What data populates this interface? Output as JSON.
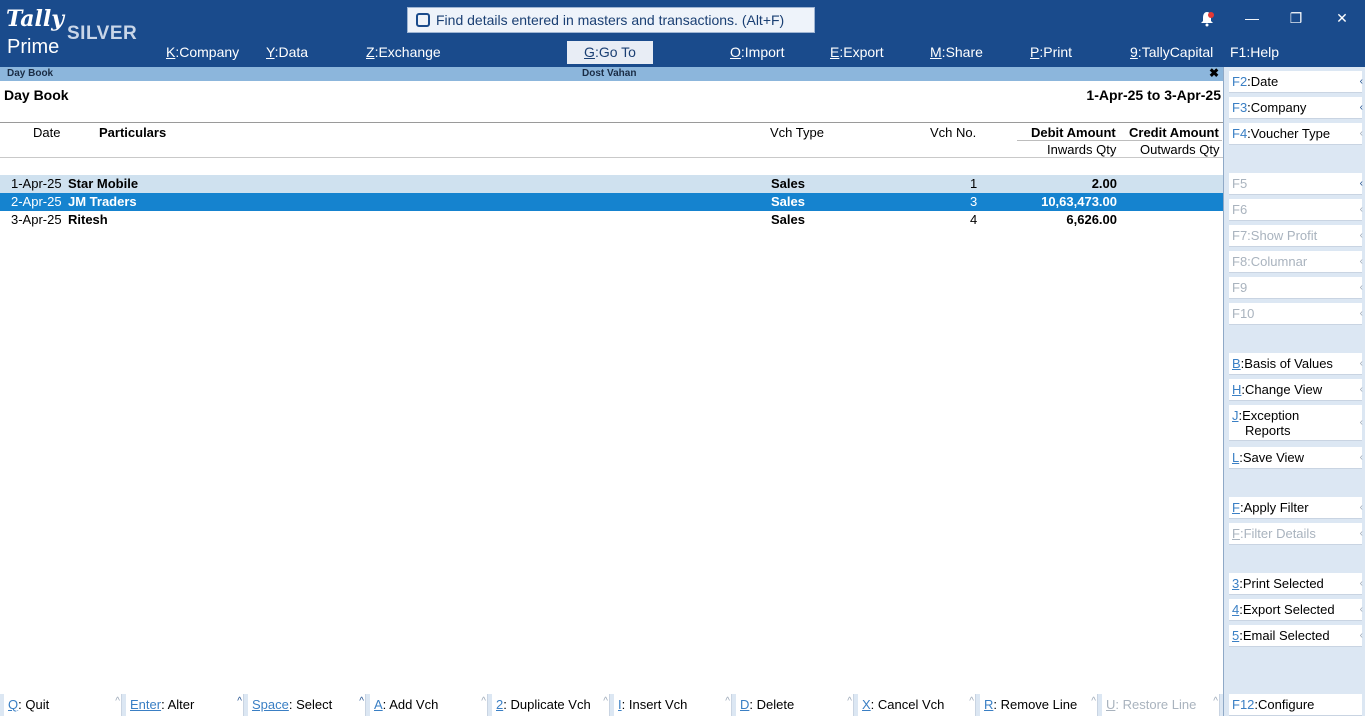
{
  "app": {
    "logo_tally": "Tally",
    "logo_prime": "Prime",
    "edition": "SILVER"
  },
  "search": {
    "placeholder": "Find details entered in masters and transactions. (Alt+F)"
  },
  "window_controls": {
    "minimize": "—",
    "restore": "❐",
    "close": "✕"
  },
  "top_menu": [
    {
      "key": "K",
      "label": "Company"
    },
    {
      "key": "Y",
      "label": "Data"
    },
    {
      "key": "Z",
      "label": "Exchange"
    },
    {
      "key": "G",
      "label": "Go To"
    },
    {
      "key": "O",
      "label": "Import"
    },
    {
      "key": "E",
      "label": "Export"
    },
    {
      "key": "M",
      "label": "Share"
    },
    {
      "key": "P",
      "label": "Print"
    },
    {
      "key": "9",
      "label": "TallyCapital"
    },
    {
      "key": "F1",
      "label": "Help"
    }
  ],
  "subbar": {
    "left": "Day Book",
    "center": "Dost Vahan",
    "close": "✖"
  },
  "report": {
    "title": "Day Book",
    "period": "1-Apr-25 to 3-Apr-25",
    "columns": {
      "date": "Date",
      "particulars": "Particulars",
      "vch_type": "Vch Type",
      "vch_no": "Vch No.",
      "debit": "Debit Amount",
      "credit": "Credit Amount",
      "inwards": "Inwards Qty",
      "outwards": "Outwards Qty"
    },
    "rows": [
      {
        "date": "1-Apr-25",
        "particulars": "Star Mobile",
        "vch_type": "Sales",
        "vch_no": "1",
        "debit": "2.00",
        "credit": ""
      },
      {
        "date": "2-Apr-25",
        "particulars": "JM Traders",
        "vch_type": "Sales",
        "vch_no": "3",
        "debit": "10,63,473.00",
        "credit": ""
      },
      {
        "date": "3-Apr-25",
        "particulars": "Ritesh",
        "vch_type": "Sales",
        "vch_no": "4",
        "debit": "6,626.00",
        "credit": ""
      }
    ]
  },
  "right_panel": [
    {
      "key": "F2",
      "label": "Date"
    },
    {
      "key": "F3",
      "label": "Company"
    },
    {
      "key": "F4",
      "label": "Voucher Type"
    },
    {
      "key": "F5",
      "label": ""
    },
    {
      "key": "F6",
      "label": ""
    },
    {
      "key": "F7",
      "label": "Show Profit"
    },
    {
      "key": "F8",
      "label": "Columnar"
    },
    {
      "key": "F9",
      "label": ""
    },
    {
      "key": "F10",
      "label": ""
    },
    {
      "key": "B",
      "label": "Basis of Values"
    },
    {
      "key": "H",
      "label": "Change View"
    },
    {
      "key": "J",
      "label": "Exception",
      "label2": "Reports"
    },
    {
      "key": "L",
      "label": "Save View"
    },
    {
      "key": "F",
      "label": "Apply Filter"
    },
    {
      "key": "F",
      "label": "Filter Details"
    },
    {
      "key": "3",
      "label": "Print Selected"
    },
    {
      "key": "4",
      "label": "Export Selected"
    },
    {
      "key": "5",
      "label": "Email Selected"
    },
    {
      "key": "F12",
      "label": "Configure"
    }
  ],
  "footer": [
    {
      "key": "Q",
      "label": "Quit"
    },
    {
      "key": "Enter",
      "label": "Alter"
    },
    {
      "key": "Space",
      "label": "Select"
    },
    {
      "key": "A",
      "label": "Add Vch"
    },
    {
      "key": "2",
      "label": "Duplicate Vch"
    },
    {
      "key": "I",
      "label": "Insert Vch"
    },
    {
      "key": "D",
      "label": "Delete"
    },
    {
      "key": "X",
      "label": "Cancel Vch"
    },
    {
      "key": "R",
      "label": "Remove Line"
    },
    {
      "key": "U",
      "label": "Restore Line"
    }
  ],
  "colors": {
    "brand": "#1a4b8c",
    "subbar": "#8cb6dc",
    "selected_row": "#1583cf",
    "alt_row": "#cfe1ef",
    "key_text": "#3a7fc4"
  }
}
